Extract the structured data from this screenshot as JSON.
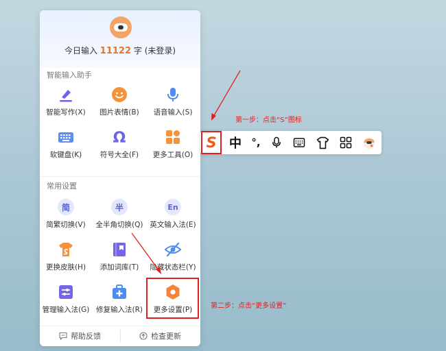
{
  "panel": {
    "count_prefix": "今日输入",
    "count_value": "11122",
    "count_unit": "字",
    "login_status": "(未登录)",
    "assistant_title": "智能输入助手",
    "assistant_items": [
      {
        "label": "智能写作(X)",
        "icon": "pen-icon"
      },
      {
        "label": "图片表情(B)",
        "icon": "emoji-icon"
      },
      {
        "label": "语音输入(S)",
        "icon": "microphone-icon"
      },
      {
        "label": "软键盘(K)",
        "icon": "keyboard-icon"
      },
      {
        "label": "符号大全(F)",
        "icon": "omega-icon"
      },
      {
        "label": "更多工具(O)",
        "icon": "grid-tools-icon"
      }
    ],
    "settings_title": "常用设置",
    "settings_items": [
      {
        "label": "简繁切换(V)",
        "glyph": "简",
        "icon": "simplified-traditional-icon"
      },
      {
        "label": "全半角切换(Q)",
        "glyph": "半",
        "icon": "fullwidth-halfwidth-icon"
      },
      {
        "label": "英文输入法(E)",
        "glyph": "En",
        "icon": "english-input-icon"
      },
      {
        "label": "更换皮肤(H)",
        "icon": "skin-shirt-icon"
      },
      {
        "label": "添加词库(T)",
        "icon": "dictionary-icon"
      },
      {
        "label": "隐藏状态栏(Y)",
        "icon": "hide-eye-icon"
      },
      {
        "label": "管理输入法(G)",
        "icon": "manage-sliders-icon"
      },
      {
        "label": "修复输入法(R)",
        "icon": "repair-kit-icon"
      },
      {
        "label": "更多设置(P)",
        "icon": "settings-hexagon-icon"
      }
    ],
    "footer": {
      "feedback": "帮助反馈",
      "update": "检查更新"
    }
  },
  "toolbar": {
    "logo_letter": "S",
    "chinese_mode": "中",
    "punctuation": "°,"
  },
  "annotations": {
    "step1": "第一步：点击“S”图标",
    "step2": "第二步：点击“更多设置”"
  },
  "colors": {
    "accent_orange": "#ee5a1e",
    "count_orange": "#e8732a",
    "highlight_red": "#e02020",
    "icon_purple": "#6b63e8"
  }
}
